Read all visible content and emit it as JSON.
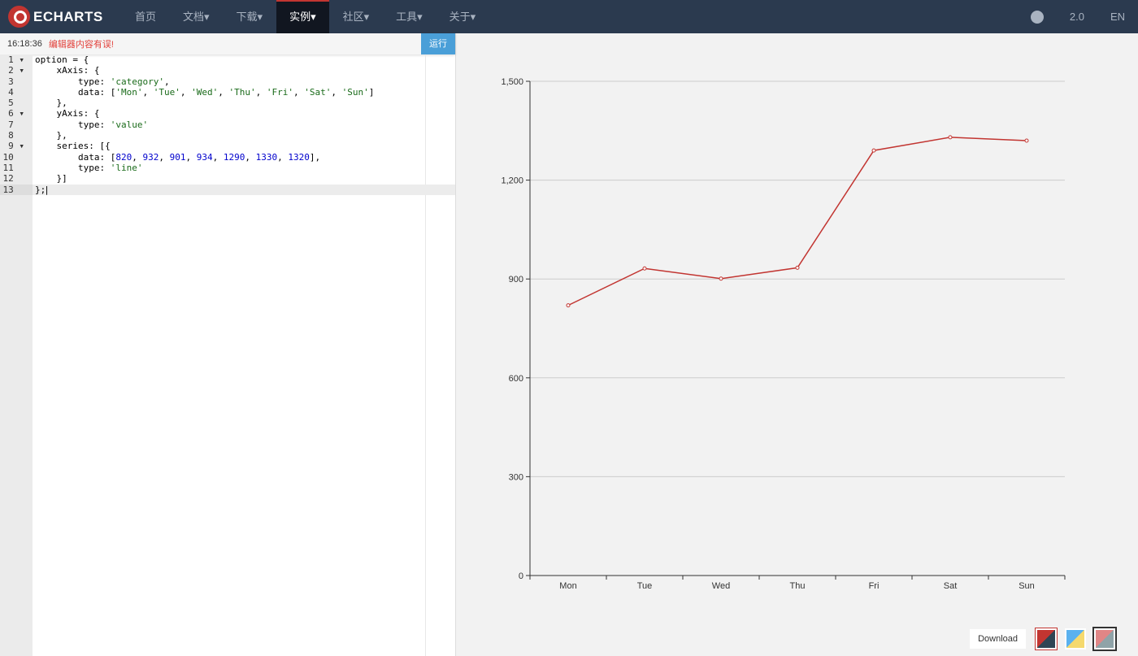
{
  "nav": {
    "logo": "ECHARTS",
    "items": [
      "首页",
      "文档▾",
      "下载▾",
      "实例▾",
      "社区▾",
      "工具▾",
      "关于▾"
    ],
    "active": 3,
    "version": "2.0",
    "lang": "EN"
  },
  "editor": {
    "time": "16:18:36",
    "error": "编辑器内容有误!",
    "run": "运行",
    "lines": [
      [
        [
          "t",
          "option = {"
        ]
      ],
      [
        [
          "t",
          "    xAxis: {"
        ]
      ],
      [
        [
          "t",
          "        type: "
        ],
        [
          "str",
          "'category'"
        ],
        [
          "t",
          ","
        ]
      ],
      [
        [
          "t",
          "        data: ["
        ],
        [
          "str",
          "'Mon'"
        ],
        [
          "t",
          ", "
        ],
        [
          "str",
          "'Tue'"
        ],
        [
          "t",
          ", "
        ],
        [
          "str",
          "'Wed'"
        ],
        [
          "t",
          ", "
        ],
        [
          "str",
          "'Thu'"
        ],
        [
          "t",
          ", "
        ],
        [
          "str",
          "'Fri'"
        ],
        [
          "t",
          ", "
        ],
        [
          "str",
          "'Sat'"
        ],
        [
          "t",
          ", "
        ],
        [
          "str",
          "'Sun'"
        ],
        [
          "t",
          "]"
        ]
      ],
      [
        [
          "t",
          "    },"
        ]
      ],
      [
        [
          "t",
          "    yAxis: {"
        ]
      ],
      [
        [
          "t",
          "        type: "
        ],
        [
          "str",
          "'value'"
        ]
      ],
      [
        [
          "t",
          "    },"
        ]
      ],
      [
        [
          "t",
          "    series: [{"
        ]
      ],
      [
        [
          "t",
          "        data: ["
        ],
        [
          "num",
          "820"
        ],
        [
          "t",
          ", "
        ],
        [
          "num",
          "932"
        ],
        [
          "t",
          ", "
        ],
        [
          "num",
          "901"
        ],
        [
          "t",
          ", "
        ],
        [
          "num",
          "934"
        ],
        [
          "t",
          ", "
        ],
        [
          "num",
          "1290"
        ],
        [
          "t",
          ", "
        ],
        [
          "num",
          "1330"
        ],
        [
          "t",
          ", "
        ],
        [
          "num",
          "1320"
        ],
        [
          "t",
          "],"
        ]
      ],
      [
        [
          "t",
          "        type: "
        ],
        [
          "str",
          "'line'"
        ]
      ],
      [
        [
          "t",
          "    }]"
        ]
      ],
      [
        [
          "t",
          "};"
        ]
      ]
    ]
  },
  "toolbar": {
    "download": "Download"
  },
  "colors": {
    "line": "#c23531",
    "themes": [
      [
        "#c23531",
        "#2f4554"
      ],
      [
        "#5ab1ef",
        "#f5d96d"
      ],
      [
        "#e08686",
        "#8fa3a8"
      ]
    ]
  },
  "chart_data": {
    "type": "line",
    "categories": [
      "Mon",
      "Tue",
      "Wed",
      "Thu",
      "Fri",
      "Sat",
      "Sun"
    ],
    "values": [
      820,
      932,
      901,
      934,
      1290,
      1330,
      1320
    ],
    "ylim": [
      0,
      1500
    ],
    "yticks": [
      "0",
      "300",
      "600",
      "900",
      "1,200",
      "1,500"
    ],
    "grid": true
  }
}
